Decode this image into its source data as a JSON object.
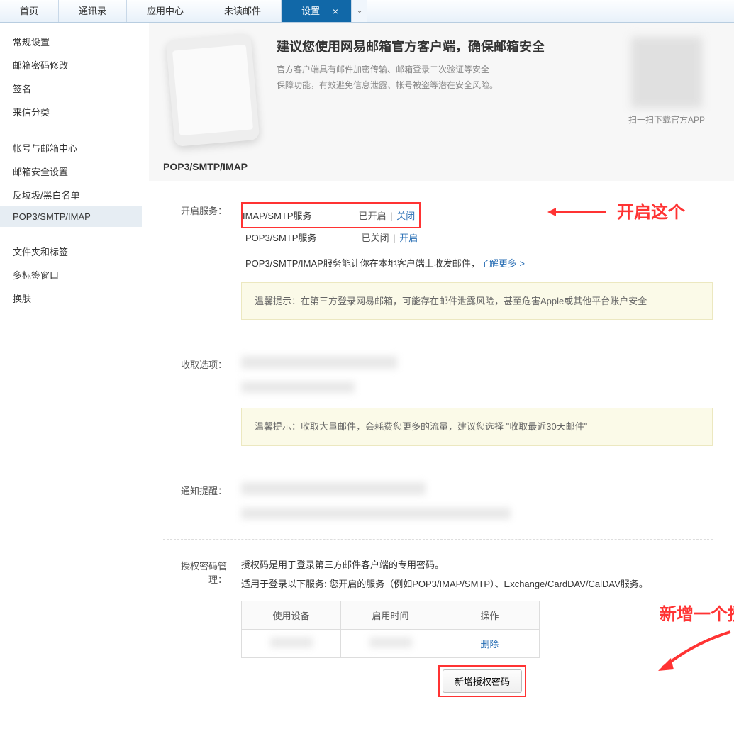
{
  "topTabs": [
    "首页",
    "通讯录",
    "应用中心",
    "未读邮件"
  ],
  "activeTab": "设置",
  "closeIcon": "×",
  "dropdownIcon": "⌄",
  "sidebar": {
    "group1": [
      "常规设置",
      "邮箱密码修改",
      "签名",
      "来信分类"
    ],
    "group2": [
      "帐号与邮箱中心",
      "邮箱安全设置",
      "反垃圾/黑白名单",
      "POP3/SMTP/IMAP"
    ],
    "group3": [
      "文件夹和标签",
      "多标签窗口",
      "换肤"
    ]
  },
  "banner": {
    "title": "建议您使用网易邮箱官方客户端，确保邮箱安全",
    "desc1": "官方客户端具有邮件加密传输、邮箱登录二次验证等安全",
    "desc2": "保障功能，有效避免信息泄露、帐号被盗等潜在安全风险。",
    "qrLabel": "扫一扫下载官方APP"
  },
  "section": {
    "header": "POP3/SMTP/IMAP",
    "enableLabel": "开启服务：",
    "imap": {
      "name": "IMAP/SMTP服务",
      "status": "已开启",
      "action": "关闭"
    },
    "pop3": {
      "name": "POP3/SMTP服务",
      "status": "已关闭",
      "action": "开启"
    },
    "serviceTip": "POP3/SMTP/IMAP服务能让你在本地客户端上收发邮件，",
    "learnMore": "了解更多 >",
    "tip1": "温馨提示：在第三方登录网易邮箱，可能存在邮件泄露风险，甚至危害Apple或其他平台账户安全",
    "receiveLabel": "收取选项：",
    "tip2": "温馨提示：收取大量邮件，会耗费您更多的流量，建议您选择 \"收取最近30天邮件\"",
    "notifyLabel": "通知提醒：",
    "authLabel": "授权密码管理：",
    "authDesc1": "授权码是用于登录第三方邮件客户端的专用密码。",
    "authDesc2": "适用于登录以下服务: 您开启的服务（例如POP3/IMAP/SMTP）、Exchange/CardDAV/CalDAV服务。",
    "table": {
      "col1": "使用设备",
      "col2": "启用时间",
      "col3": "操作",
      "delete": "删除"
    },
    "addBtn": "新增授权密码"
  },
  "annotations": {
    "a1": "开启这个",
    "a2": "新增一个授权码"
  }
}
